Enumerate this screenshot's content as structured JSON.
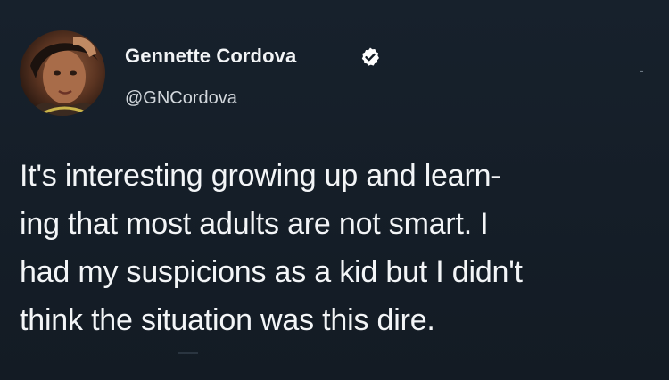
{
  "author": {
    "name": "Gennette Cordova",
    "handle": "@GNCordova",
    "verified_icon": "verified-badge-icon"
  },
  "tweet": {
    "lines": [
      "It's interesting growing up and learn-",
      "ing that most adults are not smart. I",
      "had my suspicions as a kid but I didn't",
      "think the situation was this dire."
    ]
  },
  "colors": {
    "background": "#141d26",
    "text": "#f3f5f7",
    "handle": "#d2d7dc",
    "verified": "#ffffff"
  }
}
